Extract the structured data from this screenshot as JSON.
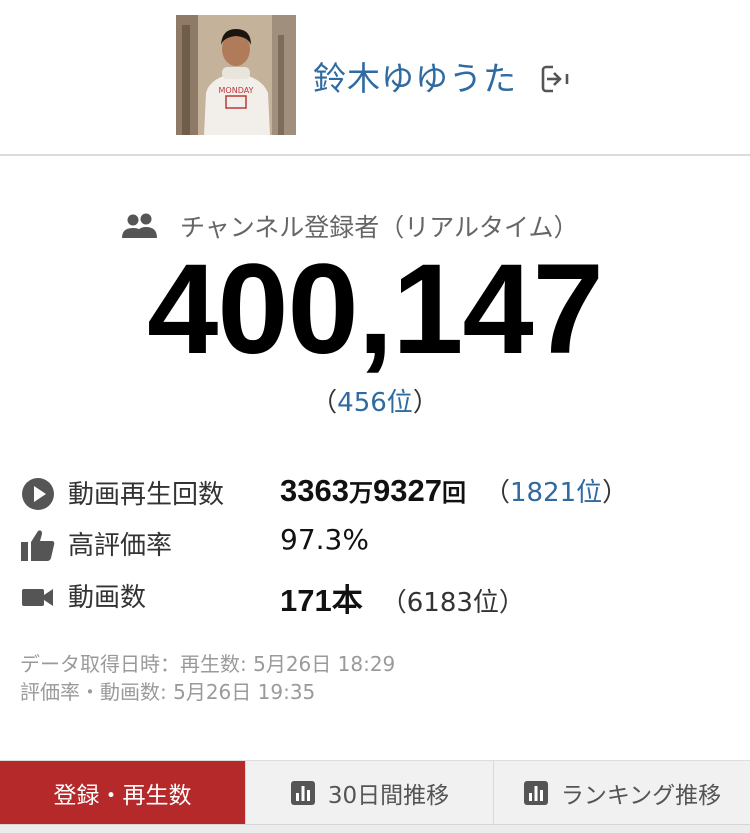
{
  "channel": {
    "name": "鈴木ゆゆうた",
    "avatar_icon": "channel-avatar-photo",
    "logout_icon": "logout-icon"
  },
  "subscribers": {
    "label": "チャンネル登録者（リアルタイム）",
    "count": "400,147",
    "rank_open": "（",
    "rank": "456位",
    "rank_close": "）"
  },
  "stats": {
    "views": {
      "label": "動画再生回数",
      "value_main": "3363",
      "value_unit": "万",
      "value_rest": "9327",
      "value_suffix": "回",
      "rank_open": "（",
      "rank": "1821位",
      "rank_close": "）"
    },
    "rating": {
      "label": "高評価率",
      "value": "97.3%"
    },
    "videos": {
      "label": "動画数",
      "value": "171本",
      "rank": "（6183位）"
    }
  },
  "notes": {
    "line1": "データ取得日時：再生数: 5月26日 18:29",
    "line2": "評価率・動画数: 5月26日 19:35"
  },
  "tabs": [
    {
      "label": "登録・再生数",
      "active": true
    },
    {
      "label": "30日間推移",
      "icon": "bar-chart-icon"
    },
    {
      "label": "ランキング推移",
      "icon": "bar-chart-icon"
    }
  ],
  "colors": {
    "accent_link": "#2f6aa1",
    "active_tab": "#b5292b",
    "icon_gray": "#555555"
  }
}
